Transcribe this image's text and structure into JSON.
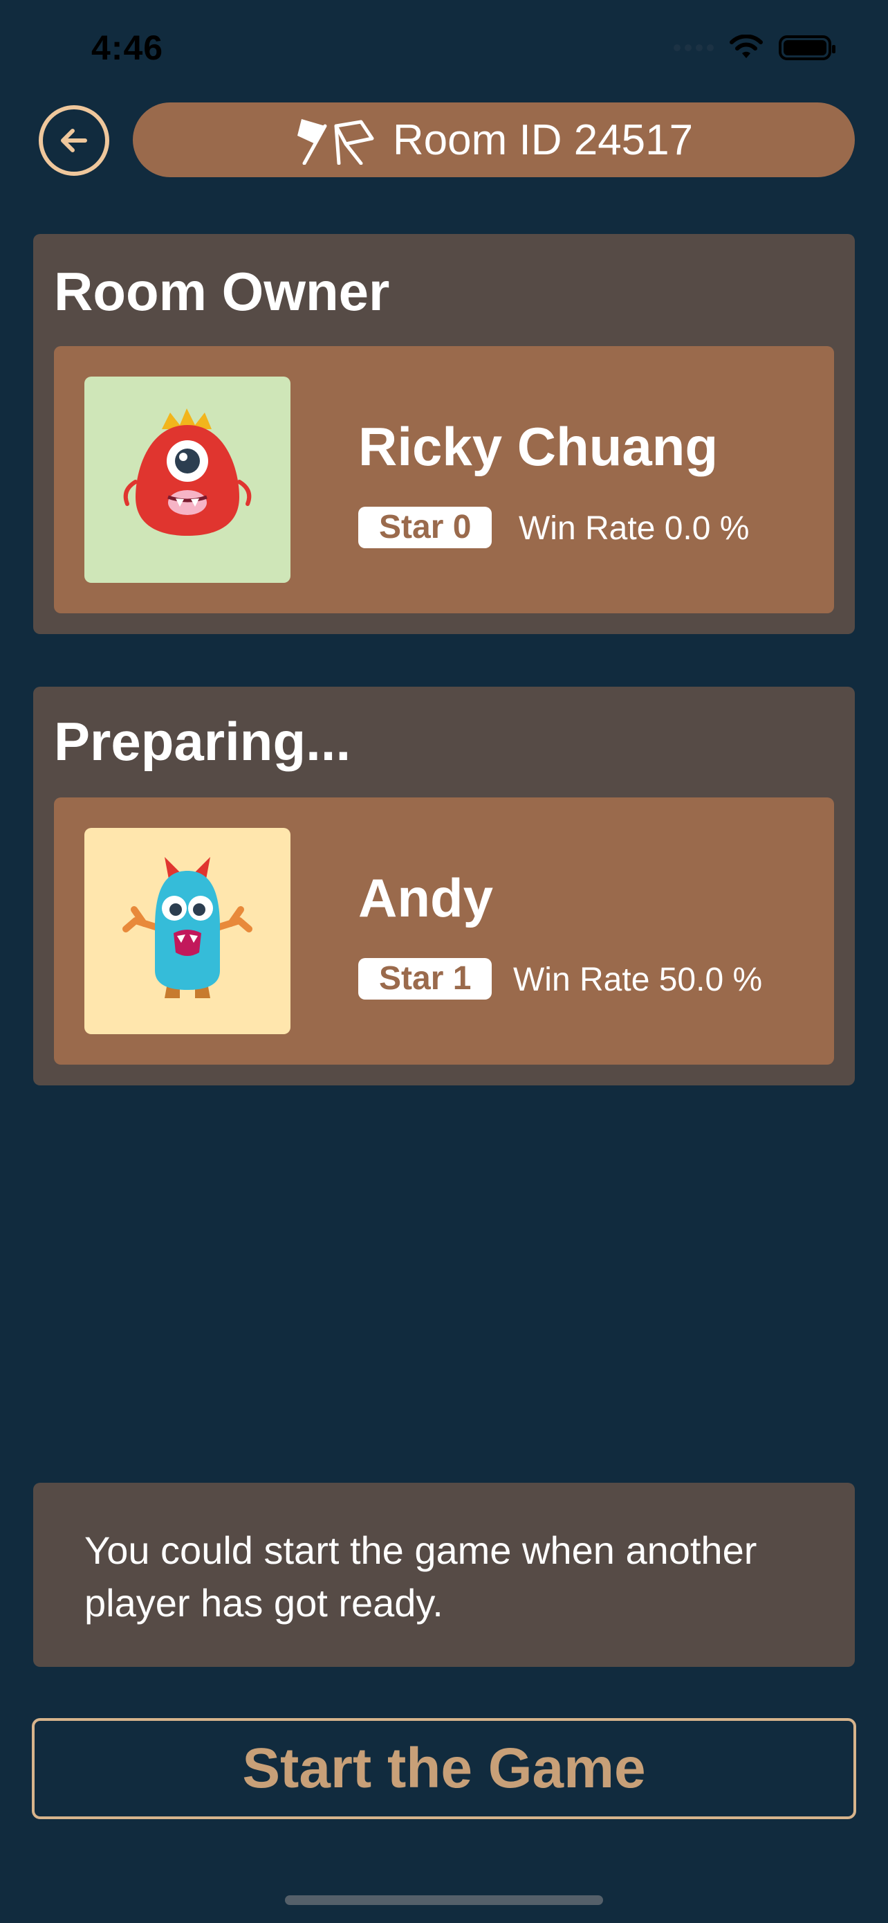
{
  "status_bar": {
    "time": "4:46"
  },
  "header": {
    "room_label": "Room ID 24517"
  },
  "owner_section": {
    "title": "Room Owner",
    "player": {
      "name": "Ricky Chuang",
      "star": "Star 0",
      "win_rate": "Win Rate 0.0 %",
      "avatar_bg": "#cfe6b8",
      "avatar_icon": "red-monster-icon"
    }
  },
  "preparing_section": {
    "title": "Preparing...",
    "player": {
      "name": "Andy",
      "star": "Star 1",
      "win_rate": "Win Rate 50.0 %",
      "avatar_bg": "#ffe6ad",
      "avatar_icon": "blue-monster-icon"
    }
  },
  "notice": {
    "text": "You could start the game when another player has got ready."
  },
  "actions": {
    "start_label": "Start the Game"
  },
  "colors": {
    "background": "#112b3e",
    "card": "#564b46",
    "accent": "#9a6a4c",
    "button_text": "#c8a078",
    "back_ring": "#efc79c"
  }
}
